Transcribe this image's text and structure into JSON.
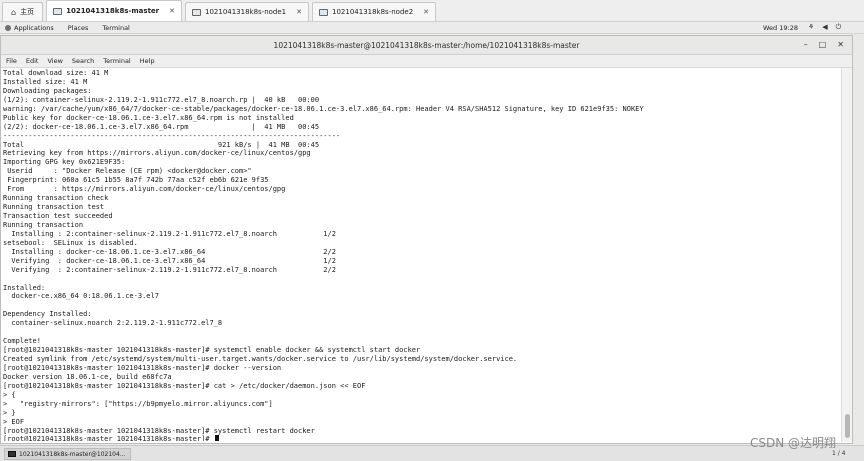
{
  "vm_tabs": [
    {
      "label": "主页",
      "icon": "home-icon"
    },
    {
      "label": "1021041318k8s-master",
      "icon": "vm-icon"
    },
    {
      "label": "1021041318k8s-node1",
      "icon": "vm-icon"
    },
    {
      "label": "1021041318k8s-node2",
      "icon": "vm-icon"
    }
  ],
  "gnome_bar": {
    "applications": "Applications",
    "places": "Places",
    "terminal": "Terminal",
    "clock": "Wed 19:28"
  },
  "window": {
    "title": "1021041318k8s-master@1021041318k8s-master:/home/1021041318k8s-master"
  },
  "menu": [
    "File",
    "Edit",
    "View",
    "Search",
    "Terminal",
    "Help"
  ],
  "terminal_lines": [
    "Total download size: 41 M",
    "Installed size: 41 M",
    "Downloading packages:",
    "(1/2): container-selinux-2.119.2-1.911c772.el7_8.noarch.rp |  40 kB   00:00",
    "warning: /var/cache/yum/x86_64/7/docker-ce-stable/packages/docker-ce-18.06.1.ce-3.el7.x86_64.rpm: Header V4 RSA/SHA512 Signature, key ID 621e9f35: NOKEY",
    "Public key for docker-ce-18.06.1.ce-3.el7.x86_64.rpm is not installed",
    "(2/2): docker-ce-18.06.1.ce-3.el7.x86_64.rpm               |  41 MB   00:45",
    "--------------------------------------------------------------------------------",
    "Total                                              921 kB/s |  41 MB  00:45",
    "Retrieving key from https://mirrors.aliyun.com/docker-ce/linux/centos/gpg",
    "Importing GPG key 0x621E9F35:",
    " Userid     : \"Docker Release (CE rpm) <docker@docker.com>\"",
    " Fingerprint: 060a 61c5 1b55 8a7f 742b 77aa c52f eb6b 621e 9f35",
    " From       : https://mirrors.aliyun.com/docker-ce/linux/centos/gpg",
    "Running transaction check",
    "Running transaction test",
    "Transaction test succeeded",
    "Running transaction",
    "  Installing : 2:container-selinux-2.119.2-1.911c772.el7_8.noarch           1/2",
    "setsebool:  SELinux is disabled.",
    "  Installing : docker-ce-18.06.1.ce-3.el7.x86_64                            2/2",
    "  Verifying  : docker-ce-18.06.1.ce-3.el7.x86_64                            1/2",
    "  Verifying  : 2:container-selinux-2.119.2-1.911c772.el7_8.noarch           2/2",
    "",
    "Installed:",
    "  docker-ce.x86_64 0:18.06.1.ce-3.el7",
    "",
    "Dependency Installed:",
    "  container-selinux.noarch 2:2.119.2-1.911c772.el7_8",
    "",
    "Complete!",
    "[root@1021041318k8s-master 1021041318k8s-master]# systemctl enable docker && systemctl start docker",
    "Created symlink from /etc/systemd/system/multi-user.target.wants/docker.service to /usr/lib/systemd/system/docker.service.",
    "[root@1021041318k8s-master 1021041318k8s-master]# docker --version",
    "Docker version 18.06.1-ce, build e68fc7a",
    "[root@1021041318k8s-master 1021041318k8s-master]# cat > /etc/docker/daemon.json << EOF",
    "> {",
    ">   \"registry-mirrors\": [\"https://b9pmyelo.mirror.aliyuncs.com\"]",
    "> }",
    "> EOF",
    "[root@1021041318k8s-master 1021041318k8s-master]# systemctl restart docker",
    "[root@1021041318k8s-master 1021041318k8s-master]# "
  ],
  "taskbar": {
    "item": "1021041318k8s-master@102104...",
    "workspace": "1 / 4"
  },
  "watermark": "CSDN @达明翔"
}
